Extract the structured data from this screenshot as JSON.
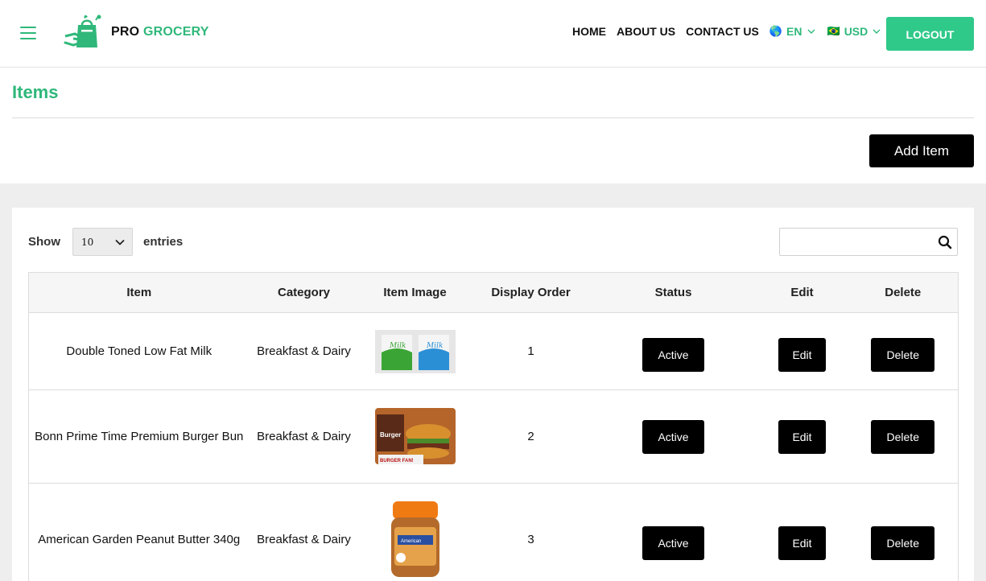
{
  "header": {
    "logo": {
      "pro": "PRO",
      "grocery": "GROCERY"
    },
    "nav": [
      "HOME",
      "ABOUT US",
      "CONTACT US"
    ],
    "language": {
      "flag": "🌎",
      "value": "EN"
    },
    "currency": {
      "flag": "🇧🇷",
      "value": "USD"
    },
    "logout_label": "LOGOUT"
  },
  "page": {
    "title": "Items",
    "add_item_label": "Add Item"
  },
  "table_controls": {
    "show_label": "Show",
    "page_size": "10",
    "entries_label": "entries",
    "search_value": ""
  },
  "table": {
    "headers": [
      "Item",
      "Category",
      "Item Image",
      "Display Order",
      "Status",
      "Edit",
      "Delete"
    ],
    "rows": [
      {
        "item": "Double Toned Low Fat Milk",
        "category": "Breakfast & Dairy",
        "image": "milk-cartons-image",
        "order": "1",
        "status": "Active",
        "edit": "Edit",
        "delete": "Delete"
      },
      {
        "item": "Bonn Prime Time Premium Burger Bun",
        "category": "Breakfast & Dairy",
        "image": "burger-bun-pack-image",
        "order": "2",
        "status": "Active",
        "edit": "Edit",
        "delete": "Delete"
      },
      {
        "item": "American Garden Peanut Butter 340g",
        "category": "Breakfast & Dairy",
        "image": "peanut-butter-jar-image",
        "order": "3",
        "status": "Active",
        "edit": "Edit",
        "delete": "Delete"
      }
    ]
  },
  "colors": {
    "accent": "#2fb87a",
    "logout": "#2fc98a",
    "button": "#000000",
    "section_bg": "#eeeeee"
  }
}
